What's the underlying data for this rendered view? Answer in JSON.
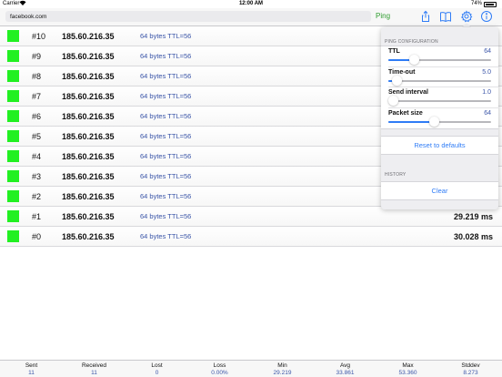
{
  "status_bar": {
    "carrier": "Carrier",
    "wifi_icon": "wifi-icon",
    "time": "12:00 AM",
    "battery_percent": "74%",
    "battery_icon": "battery-icon"
  },
  "toolbar": {
    "url_value": "facebook.com",
    "ping_label": "Ping",
    "icons": [
      "share-icon",
      "bookmarks-icon",
      "gear-icon",
      "info-icon"
    ],
    "accent_color": "#2e9c2e"
  },
  "ping_rows": [
    {
      "seq": "#10",
      "ip": "185.60.216.35",
      "reply": "64 bytes TTL=56",
      "time": ""
    },
    {
      "seq": "#9",
      "ip": "185.60.216.35",
      "reply": "64 bytes TTL=56",
      "time": ""
    },
    {
      "seq": "#8",
      "ip": "185.60.216.35",
      "reply": "64 bytes TTL=56",
      "time": ""
    },
    {
      "seq": "#7",
      "ip": "185.60.216.35",
      "reply": "64 bytes TTL=56",
      "time": ""
    },
    {
      "seq": "#6",
      "ip": "185.60.216.35",
      "reply": "64 bytes TTL=56",
      "time": ""
    },
    {
      "seq": "#5",
      "ip": "185.60.216.35",
      "reply": "64 bytes TTL=56",
      "time": ""
    },
    {
      "seq": "#4",
      "ip": "185.60.216.35",
      "reply": "64 bytes TTL=56",
      "time": ""
    },
    {
      "seq": "#3",
      "ip": "185.60.216.35",
      "reply": "64 bytes TTL=56",
      "time": ""
    },
    {
      "seq": "#2",
      "ip": "185.60.216.35",
      "reply": "64 bytes TTL=56",
      "time": ""
    },
    {
      "seq": "#1",
      "ip": "185.60.216.35",
      "reply": "64 bytes TTL=56",
      "time": "29.219 ms"
    },
    {
      "seq": "#0",
      "ip": "185.60.216.35",
      "reply": "64 bytes TTL=56",
      "time": "30.028 ms"
    }
  ],
  "success_color": "#22f022",
  "config": {
    "section_title": "PING CONFIGURATION",
    "settings": [
      {
        "name": "TTL",
        "value": "64",
        "level": 0.25
      },
      {
        "name": "Time-out",
        "value": "5.0",
        "level": 0.08
      },
      {
        "name": "Send interval",
        "value": "1.0",
        "level": 0.0
      },
      {
        "name": "Packet size",
        "value": "64",
        "level": 0.45
      }
    ],
    "reset_label": "Reset to defaults",
    "history_title": "HISTORY",
    "clear_label": "Clear"
  },
  "stats": [
    {
      "label": "Sent",
      "value": "11"
    },
    {
      "label": "Received",
      "value": "11"
    },
    {
      "label": "Lost",
      "value": "0"
    },
    {
      "label": "Loss",
      "value": "0.00%"
    },
    {
      "label": "Min",
      "value": "29.219"
    },
    {
      "label": "Avg",
      "value": "33.861"
    },
    {
      "label": "Max",
      "value": "53.360"
    },
    {
      "label": "Stddev",
      "value": "8.273"
    }
  ]
}
